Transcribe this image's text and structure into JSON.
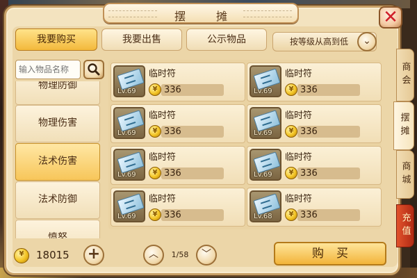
{
  "title": "摆　摊",
  "close_icon": "close-icon",
  "tabs": [
    {
      "label": "我要购买",
      "active": true
    },
    {
      "label": "我要出售",
      "active": false
    },
    {
      "label": "公示物品",
      "active": false
    }
  ],
  "sort": {
    "label": "按等级从高到低",
    "icon": "chevron-down-icon"
  },
  "search": {
    "placeholder": "输入物品名称",
    "icon": "search-icon"
  },
  "categories": [
    {
      "label": "物理防御",
      "active": false
    },
    {
      "label": "物理伤害",
      "active": false
    },
    {
      "label": "法术伤害",
      "active": true
    },
    {
      "label": "法术防御",
      "active": false
    },
    {
      "label": "愤怒",
      "active": false
    }
  ],
  "items": [
    {
      "name": "临时符",
      "level": "Lv.69",
      "price": "336"
    },
    {
      "name": "临时符",
      "level": "Lv.69",
      "price": "336"
    },
    {
      "name": "临时符",
      "level": "Lv.69",
      "price": "336"
    },
    {
      "name": "临时符",
      "level": "Lv.69",
      "price": "336"
    },
    {
      "name": "临时符",
      "level": "Lv.69",
      "price": "336"
    },
    {
      "name": "临时符",
      "level": "Lv.69",
      "price": "336"
    },
    {
      "name": "临时符",
      "level": "Lv.69",
      "price": "336"
    },
    {
      "name": "临时符",
      "level": "Lv.68",
      "price": "336"
    }
  ],
  "side_tabs": [
    {
      "label": "商会",
      "active": false
    },
    {
      "label": "摆摊",
      "active": true
    },
    {
      "label": "商城",
      "active": false
    },
    {
      "label": "充值",
      "active": false
    }
  ],
  "money": "18015",
  "add_label": "+",
  "pager": {
    "text": "1/58",
    "up_icon": "chevron-up-icon",
    "down_icon": "chevron-down-icon"
  },
  "buy_label": "购买"
}
